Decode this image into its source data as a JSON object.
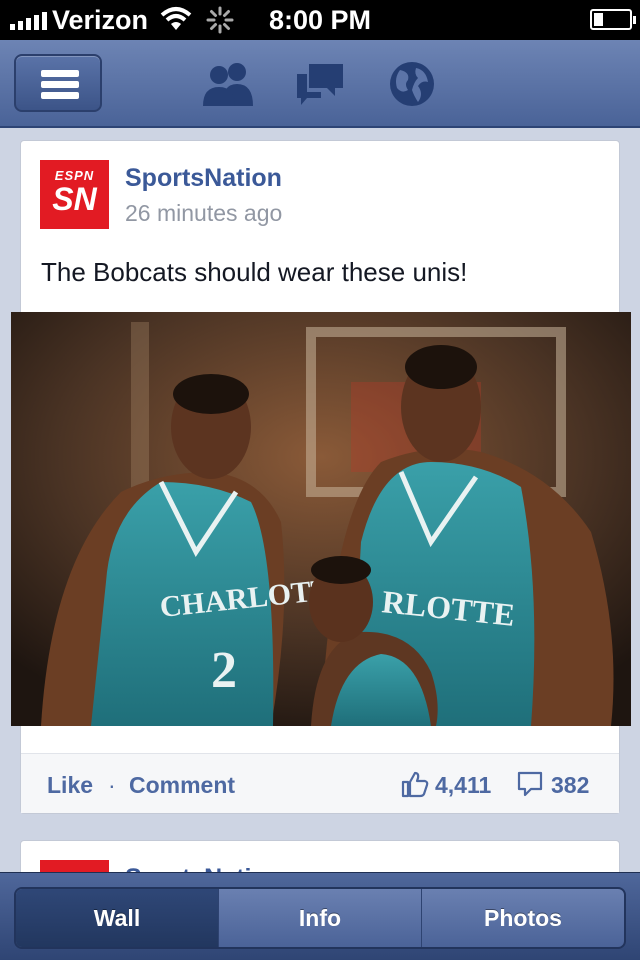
{
  "status_bar": {
    "carrier": "Verizon",
    "time": "8:00 PM",
    "signal_bars": 5,
    "battery_level": 0.25
  },
  "nav": {
    "icons": [
      "menu-icon",
      "friends-icon",
      "messages-icon",
      "notifications-globe-icon"
    ]
  },
  "posts": [
    {
      "page_name": "SportsNation",
      "avatar_brand": "ESPN",
      "avatar_monogram": "SN",
      "time_ago": "26 minutes ago",
      "text": "The Bobcats should wear these unis!",
      "photo_subject": "Three Charlotte Hornets players in teal jerseys",
      "jersey_text_left": "CHARLOTTE",
      "jersey_number_left": "2",
      "jersey_text_right": "RLOTTE",
      "actions": {
        "like": "Like",
        "separator": "·",
        "comment": "Comment"
      },
      "likes": "4,411",
      "comments": "382"
    },
    {
      "page_name": "SportsNation"
    }
  ],
  "tabs": [
    {
      "label": "Wall",
      "active": true
    },
    {
      "label": "Info",
      "active": false
    },
    {
      "label": "Photos",
      "active": false
    }
  ],
  "colors": {
    "facebook_blue": "#3b5998",
    "nav_blue": "#4a6398",
    "espn_red": "#e21b23",
    "jersey_teal": "#2f8c98"
  }
}
